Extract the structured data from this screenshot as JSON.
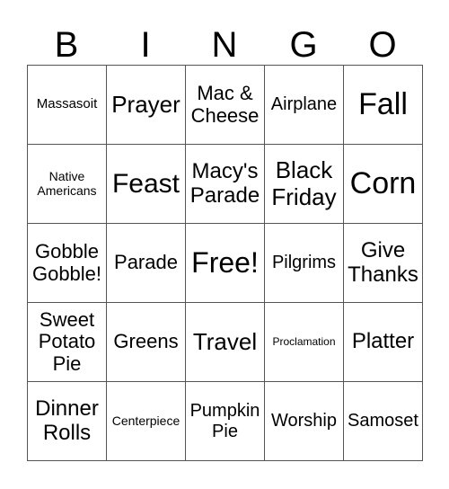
{
  "header": [
    "B",
    "I",
    "N",
    "G",
    "O"
  ],
  "cells": [
    "Massasoit",
    "Prayer",
    "Mac & Cheese",
    "Airplane",
    "Fall",
    "Native Americans",
    "Feast",
    "Macy's Parade",
    "Black Friday",
    "Corn",
    "Gobble Gobble!",
    "Parade",
    "Free!",
    "Pilgrims",
    "Give Thanks",
    "Sweet Potato Pie",
    "Greens",
    "Travel",
    "Proclamation",
    "Platter",
    "Dinner Rolls",
    "Centerpiece",
    "Pumpkin Pie",
    "Worship",
    "Samoset"
  ]
}
